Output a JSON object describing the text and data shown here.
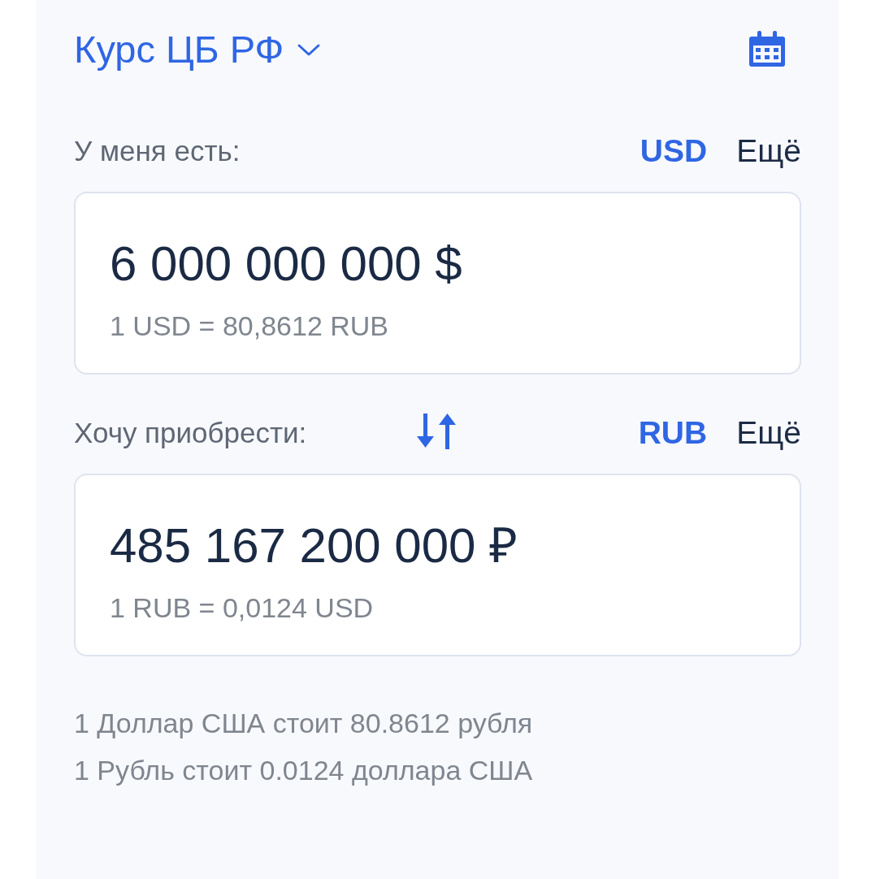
{
  "header": {
    "title": "Курс ЦБ РФ"
  },
  "sections": [
    {
      "label": "У меня есть:",
      "swap": false,
      "currencies": [
        {
          "label": "USD",
          "selected": true
        },
        {
          "label": "Ещё",
          "selected": false
        }
      ],
      "amount": "6 000 000 000 $",
      "rate": "1 USD = 80,8612 RUB"
    },
    {
      "label": "Хочу приобрести:",
      "swap": true,
      "currencies": [
        {
          "label": "RUB",
          "selected": true
        },
        {
          "label": "Ещё",
          "selected": false
        }
      ],
      "amount": "485 167 200 000 ₽",
      "rate": "1 RUB = 0,0124 USD"
    }
  ],
  "notes": [
    "1 Доллар США стоит 80.8612 рубля",
    "1 Рубль стоит 0.0124 доллара США"
  ]
}
